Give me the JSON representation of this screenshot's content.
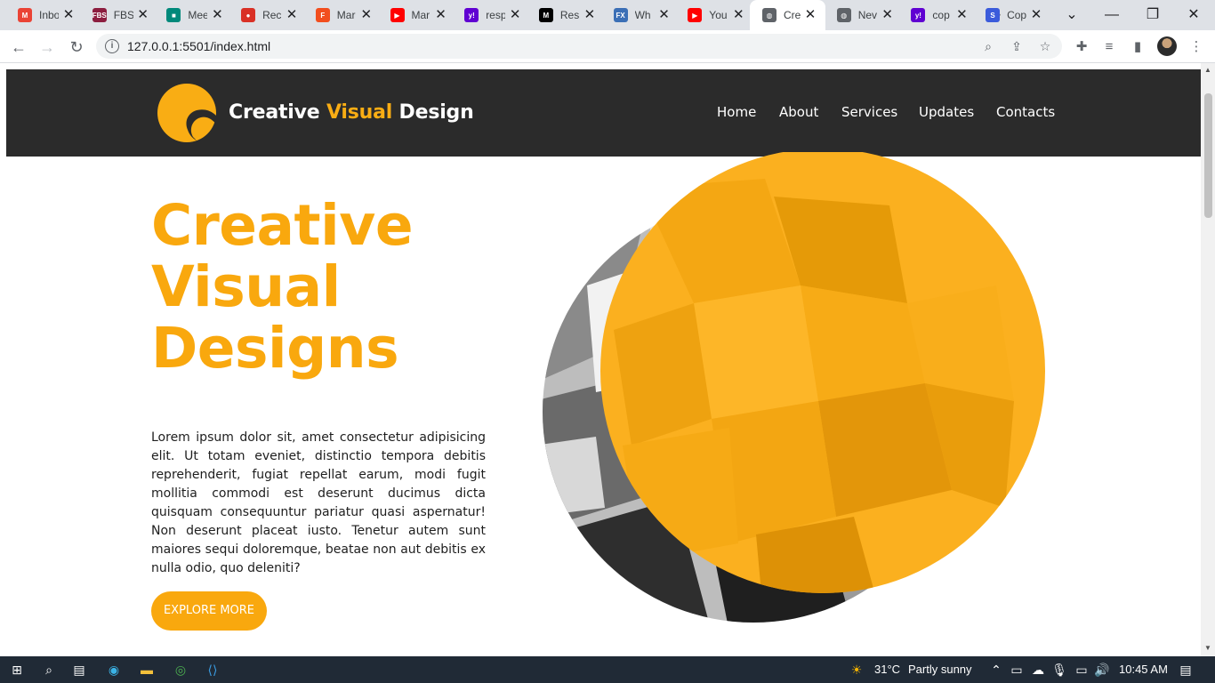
{
  "browser": {
    "tabs": [
      {
        "title": "Inbox",
        "icon": "gmail-icon",
        "color": "#ea4335",
        "glyph": "M"
      },
      {
        "title": "FBS",
        "icon": "fbs-icon",
        "color": "#8c1d3f",
        "glyph": "FBS"
      },
      {
        "title": "Meet",
        "icon": "meet-icon",
        "color": "#00897b",
        "glyph": "■"
      },
      {
        "title": "Rec",
        "icon": "record-icon",
        "color": "#d93025",
        "glyph": "●"
      },
      {
        "title": "Mar",
        "icon": "figma-icon",
        "color": "#f24e1e",
        "glyph": "F"
      },
      {
        "title": "Mar",
        "icon": "youtube-icon",
        "color": "#ff0000",
        "glyph": "▶"
      },
      {
        "title": "resp",
        "icon": "yahoo-icon",
        "color": "#6001d2",
        "glyph": "y!"
      },
      {
        "title": "Res",
        "icon": "medium-icon",
        "color": "#000000",
        "glyph": "M"
      },
      {
        "title": "Wh",
        "icon": "fx-icon",
        "color": "#3b6fb6",
        "glyph": "FX"
      },
      {
        "title": "You",
        "icon": "youtube-icon",
        "color": "#ff0000",
        "glyph": "▶"
      },
      {
        "title": "Cre",
        "icon": "globe-icon",
        "color": "#5f6368",
        "glyph": "◍"
      },
      {
        "title": "Nev",
        "icon": "globe-icon",
        "color": "#5f6368",
        "glyph": "◍"
      },
      {
        "title": "cop",
        "icon": "yahoo-icon",
        "color": "#6001d2",
        "glyph": "y!"
      },
      {
        "title": "Cop",
        "icon": "s-icon",
        "color": "#3b5bdb",
        "glyph": "S"
      }
    ],
    "active_tab_index": 10,
    "new_tab": "+",
    "url": "127.0.0.1:5501/index.html"
  },
  "site": {
    "brand_part1": "Creative ",
    "brand_part2": "Visual",
    "brand_part3": " Design",
    "accent_color": "#f9ad14",
    "nav": [
      "Home",
      "About",
      "Services",
      "Updates",
      "Contacts"
    ],
    "hero_line1": "Creative",
    "hero_line2": "Visual",
    "hero_line3": "Designs",
    "hero_text": "Lorem ipsum dolor sit, amet consectetur adipisicing elit. Ut totam eveniet, distinctio tempora debitis reprehenderit, fugiat repellat earum, modi fugit mollitia commodi est deserunt ducimus dicta quisquam consequuntur pariatur quasi aspernatur! Non deserunt placeat iusto. Tenetur autem sunt maiores sequi doloremque, beatae non aut debitis ex nulla odio, quo deleniti?",
    "cta": "EXPLORE MORE"
  },
  "taskbar": {
    "weather_temp": "31°C",
    "weather_text": "Partly sunny",
    "time": "10:45 AM"
  }
}
